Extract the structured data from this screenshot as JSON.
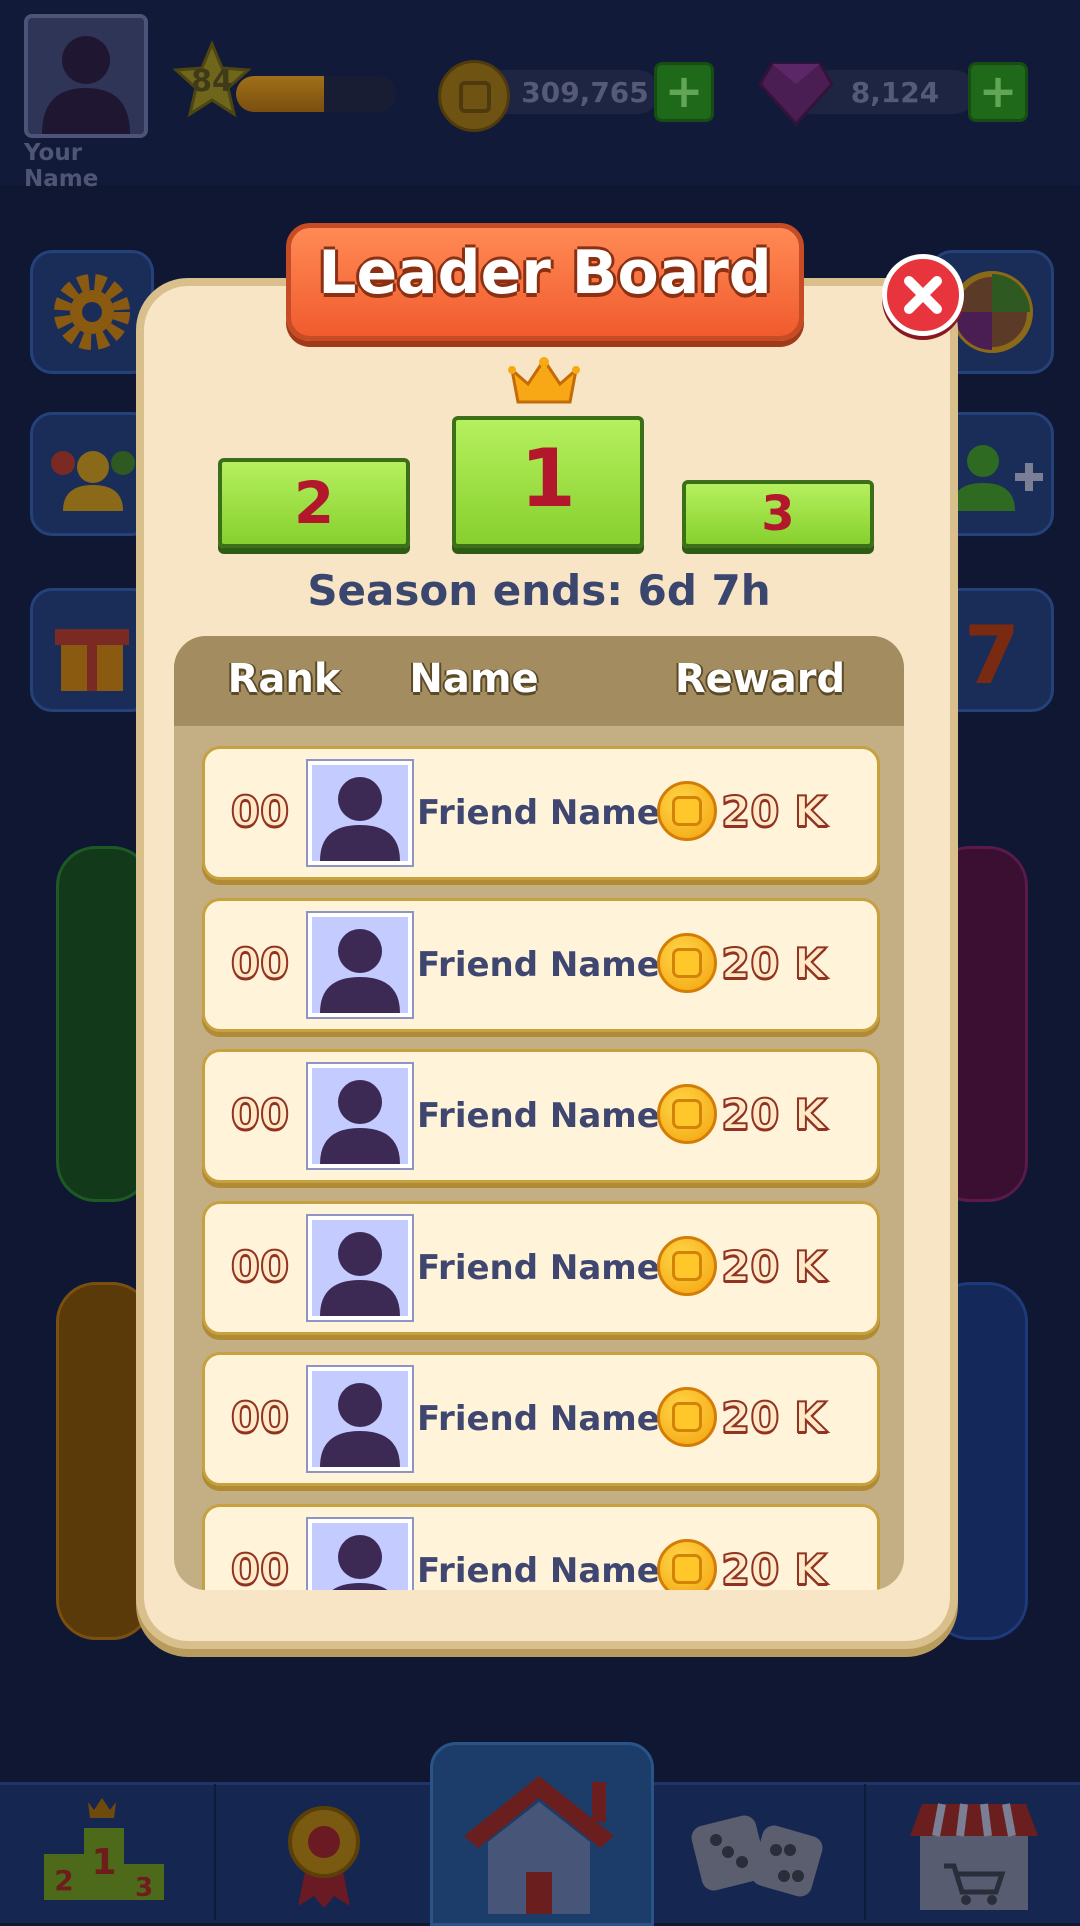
{
  "player": {
    "name": "Your Name",
    "level": "84",
    "xp_progress": 0.55
  },
  "currency": {
    "coins": "309,765",
    "gems": "8,124",
    "plus": "+"
  },
  "modal": {
    "title": "Leader Board",
    "close": "X",
    "podium": {
      "first": "1",
      "second": "2",
      "third": "3"
    },
    "season_text": "Season ends: 6d 7h",
    "headers": {
      "rank": "Rank",
      "name": "Name",
      "reward": "Reward"
    },
    "rows": [
      {
        "rank": "00",
        "name": "Friend Name",
        "reward": "20 K"
      },
      {
        "rank": "00",
        "name": "Friend Name",
        "reward": "20 K"
      },
      {
        "rank": "00",
        "name": "Friend Name",
        "reward": "20 K"
      },
      {
        "rank": "00",
        "name": "Friend Name",
        "reward": "20 K"
      },
      {
        "rank": "00",
        "name": "Friend Name",
        "reward": "20 K"
      },
      {
        "rank": "00",
        "name": "Friend Name",
        "reward": "20 K"
      }
    ]
  },
  "nav": {
    "items": [
      {
        "icon": "leaderboard-podium-icon"
      },
      {
        "icon": "award-medal-icon"
      },
      {
        "icon": "home-icon"
      },
      {
        "icon": "dice-icon"
      },
      {
        "icon": "shop-icon"
      }
    ]
  },
  "colors": {
    "accent_orange": "#f15b2e",
    "podium_green": "#9ee04a",
    "close_red": "#e8343c"
  }
}
